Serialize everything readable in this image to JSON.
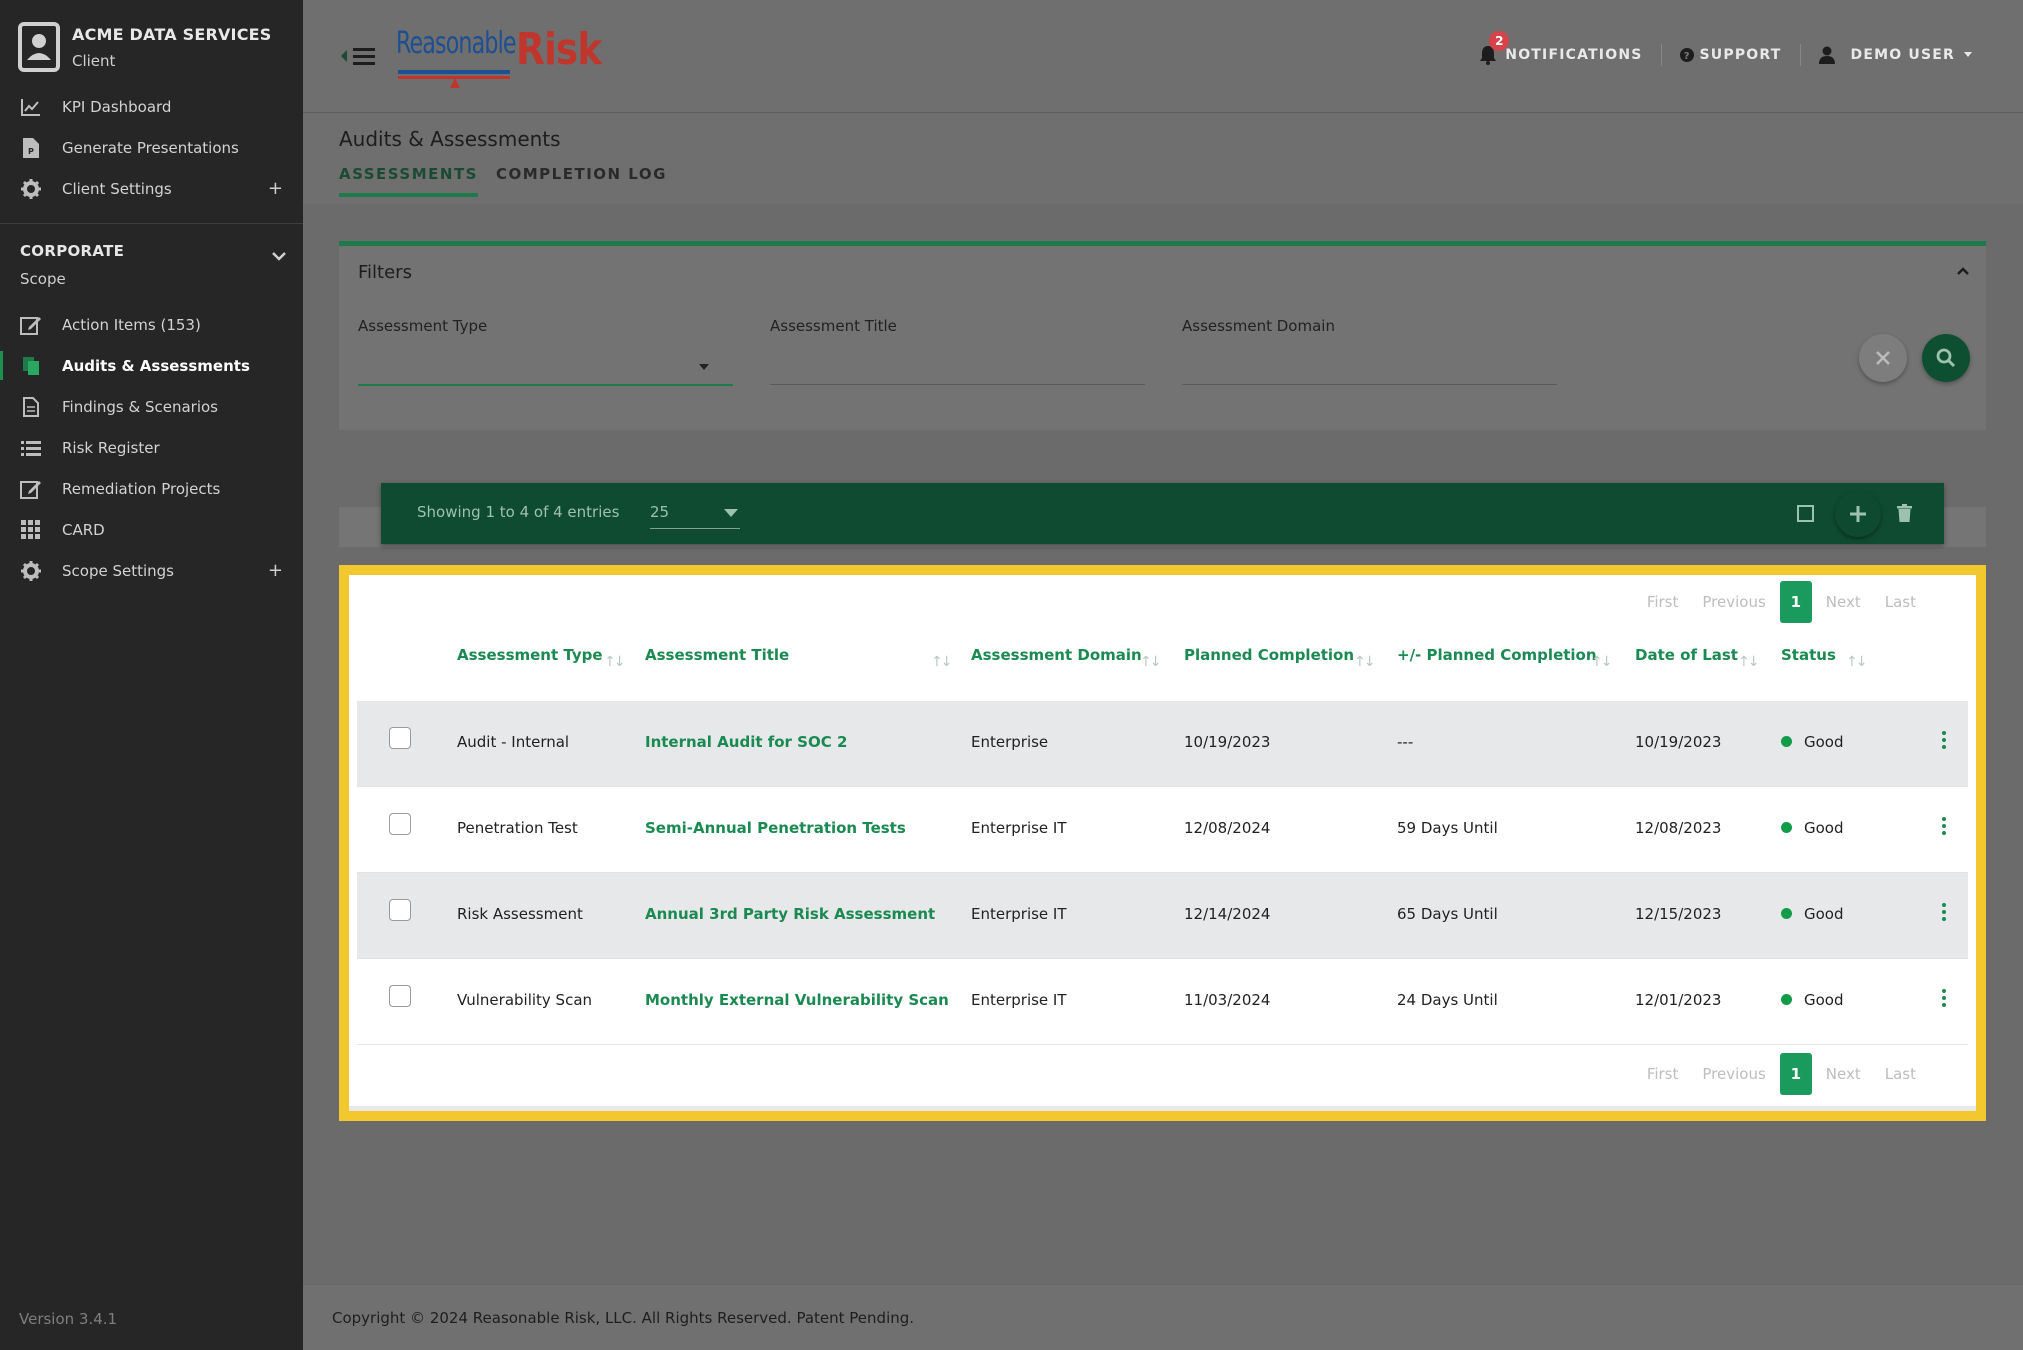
{
  "sidebar": {
    "client_name": "ACME DATA SERVICES",
    "client_sub": "Client",
    "top_items": [
      {
        "label": "KPI Dashboard",
        "icon": "chart-line-icon"
      },
      {
        "label": "Generate Presentations",
        "icon": "file-powerpoint-icon"
      },
      {
        "label": "Client Settings",
        "icon": "gear-icon",
        "plus": "+"
      }
    ],
    "scope_title": "CORPORATE",
    "scope_sub": "Scope",
    "scope_items": [
      {
        "label": "Action Items (153)",
        "icon": "edit-icon"
      },
      {
        "label": "Audits & Assessments",
        "icon": "copy-icon",
        "active": true
      },
      {
        "label": "Findings & Scenarios",
        "icon": "document-icon"
      },
      {
        "label": "Risk Register",
        "icon": "list-icon"
      },
      {
        "label": "Remediation Projects",
        "icon": "edit-icon"
      },
      {
        "label": "CARD",
        "icon": "grid-icon"
      },
      {
        "label": "Scope Settings",
        "icon": "gear-icon",
        "plus": "+"
      }
    ],
    "version": "Version 3.4.1"
  },
  "header": {
    "logo_reasonable": "Reasonable",
    "logo_risk": "Risk",
    "notifications_label": "NOTIFICATIONS",
    "notifications_count": "2",
    "support_label": "SUPPORT",
    "user_label": "DEMO USER"
  },
  "page": {
    "title": "Audits & Assessments",
    "tabs": [
      "ASSESSMENTS",
      "COMPLETION LOG"
    ]
  },
  "filters": {
    "title": "Filters",
    "fields": [
      "Assessment Type",
      "Assessment Title",
      "Assessment Domain"
    ]
  },
  "toolbar": {
    "showing": "Showing 1 to 4 of 4 entries",
    "per_page": "25"
  },
  "pagination": {
    "first": "First",
    "previous": "Previous",
    "current": "1",
    "next": "Next",
    "last": "Last"
  },
  "table": {
    "columns": [
      "Assessment Type",
      "Assessment Title",
      "Assessment Domain",
      "Planned Completion",
      "+/- Planned Completion",
      "Date of Last",
      "Status"
    ],
    "rows": [
      {
        "type": "Audit - Internal",
        "title": "Internal Audit for SOC 2",
        "domain": "Enterprise",
        "planned": "10/19/2023",
        "delta": "---",
        "last": "10/19/2023",
        "status": "Good"
      },
      {
        "type": "Penetration Test",
        "title": "Semi-Annual Penetration Tests",
        "domain": "Enterprise IT",
        "planned": "12/08/2024",
        "delta": "59 Days Until",
        "last": "12/08/2023",
        "status": "Good"
      },
      {
        "type": "Risk Assessment",
        "title": "Annual 3rd Party Risk Assessment",
        "domain": "Enterprise IT",
        "planned": "12/14/2024",
        "delta": "65 Days Until",
        "last": "12/15/2023",
        "status": "Good"
      },
      {
        "type": "Vulnerability Scan",
        "title": "Monthly External Vulnerability Scan",
        "domain": "Enterprise IT",
        "planned": "11/03/2024",
        "delta": "24 Days Until",
        "last": "12/01/2023",
        "status": "Good"
      }
    ]
  },
  "footer": {
    "copyright": "Copyright © 2024 Reasonable Risk, LLC. All Rights Reserved. Patent Pending."
  },
  "colors": {
    "accent_green": "#1b8a52",
    "dark_green": "#0f4b31",
    "highlight_yellow": "#f3c82f",
    "sidebar_bg": "#262626",
    "badge_red": "#d6434b"
  }
}
